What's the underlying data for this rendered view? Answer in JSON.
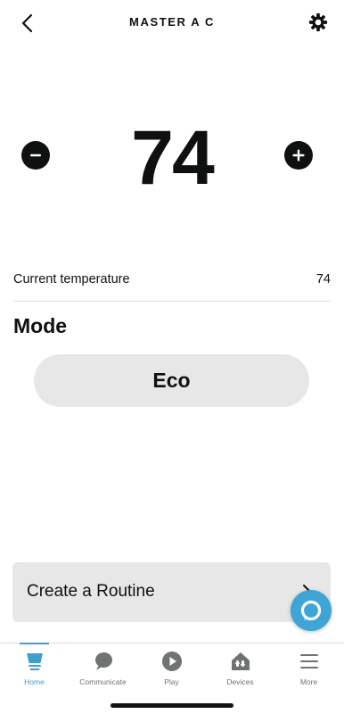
{
  "header": {
    "title": "MASTER A C",
    "back_icon": "chevron-left-icon",
    "settings_icon": "gear-icon"
  },
  "thermostat": {
    "setpoint": "74",
    "decrease_icon": "minus-circle-icon",
    "increase_icon": "plus-circle-icon"
  },
  "current": {
    "label": "Current temperature",
    "value": "74"
  },
  "mode": {
    "title": "Mode",
    "selected": "Eco"
  },
  "routine": {
    "label": "Create a Routine"
  },
  "tabs": [
    {
      "label": "Home",
      "icon": "home-icon",
      "active": true
    },
    {
      "label": "Communicate",
      "icon": "chat-bubble-icon",
      "active": false
    },
    {
      "label": "Play",
      "icon": "play-icon",
      "active": false
    },
    {
      "label": "Devices",
      "icon": "devices-icon",
      "active": false
    },
    {
      "label": "More",
      "icon": "menu-icon",
      "active": false
    }
  ],
  "colors": {
    "accent": "#3f9fcf",
    "alexa_button": "#3fa5d6",
    "pill_background": "#e7e7e7",
    "text": "#0f1111",
    "inactive_tab": "#6f7373"
  }
}
